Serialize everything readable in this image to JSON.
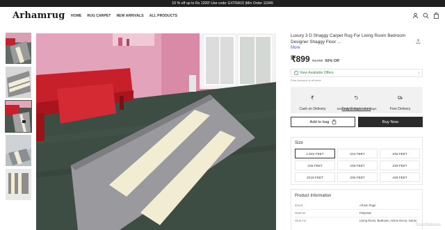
{
  "announcement": "10 % off up to Rs 1200! Use code: EXTRA10 |Min Order 11949",
  "header": {
    "logo": "Arhamrug",
    "nav": [
      "HOME",
      "RUG CARPET",
      "NEW ARRIVALS",
      "ALL PRODUCTS"
    ],
    "icons": [
      "user-icon",
      "search-icon",
      "bag-icon"
    ]
  },
  "product": {
    "title": "Luxury 3 D Shaggy Carpet Rug For Living Room Bedroom Designer Shaggy Floor ...",
    "more_label": "More",
    "price": "₹899",
    "mrp": "₹1,796",
    "discount": "50% Off",
    "offers_label": "View Available Offers",
    "tax_note": "Price inclusive of all taxes",
    "shipping": [
      "Cash on Delivery",
      "Easy 3 days return",
      "Free Delivery"
    ],
    "delivery_note": "Get it delivered in 3-6 days",
    "add_to_bag": "Add to bag",
    "buy_now": "Buy Now"
  },
  "size": {
    "heading": "Size",
    "options": [
      "1.5X4 FEET",
      "2X4 FEET",
      "2X5 FEET",
      "2X6 FEET",
      "2X8 FEET",
      "2X9 FEET",
      "2X10 FEET",
      "3X5 FEET",
      "4X6 FEET"
    ],
    "selected": "1.5X4 FEET"
  },
  "product_info": {
    "heading": "Product Information",
    "rows": [
      {
        "key": "Brand",
        "value": "Arham Rugs"
      },
      {
        "key": "Material",
        "value": "Polyester"
      },
      {
        "key": "Ideal For",
        "value": "Living Room, Bedroom, Home Decor, Indoor"
      }
    ]
  },
  "watermark": "ScanMalware",
  "colors": {
    "accent_dark": "#2b2b2b",
    "offer_green": "#2c8c3f",
    "link_blue": "#3b55d4",
    "sofa_red": "#c8202a",
    "wall_pink": "#d98aa6",
    "floor_green": "#3d4d44"
  }
}
